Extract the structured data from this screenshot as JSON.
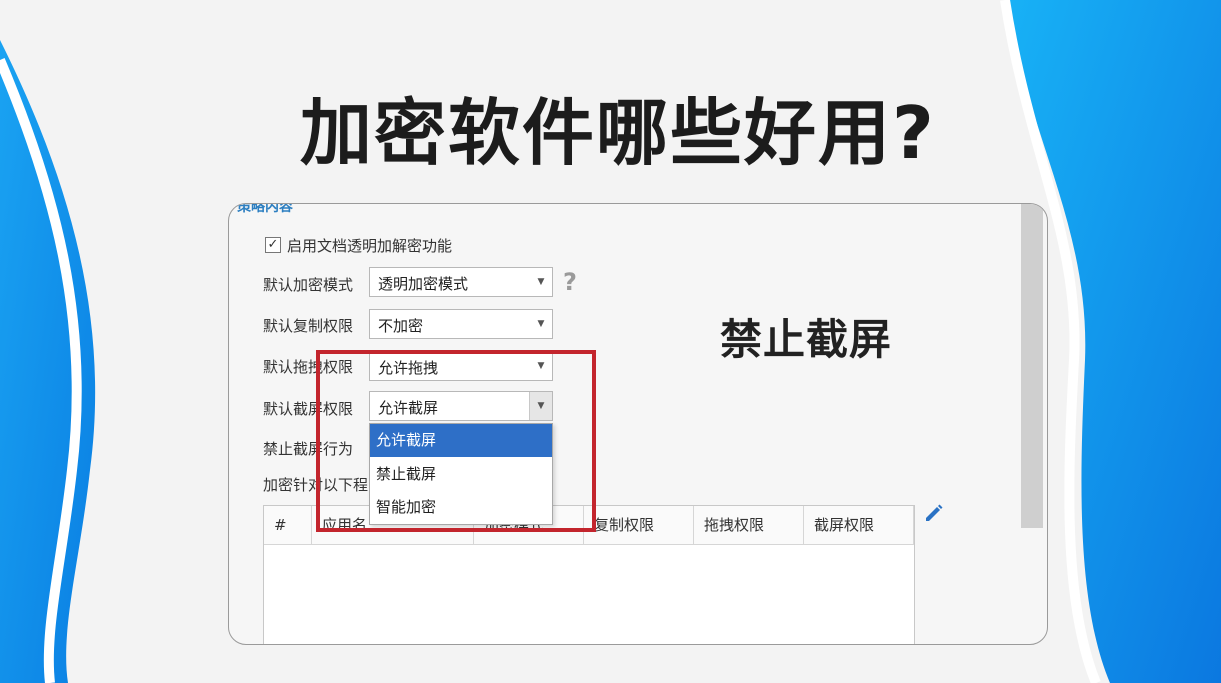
{
  "headline": "加密软件哪些好用?",
  "callout": "禁止截屏",
  "settings": {
    "section_title": "策略内容",
    "enable_checkbox": {
      "checked": true,
      "label": "启用文档透明加解密功能"
    },
    "rows": [
      {
        "label": "默认加密模式",
        "value": "透明加密模式"
      },
      {
        "label": "默认复制权限",
        "value": "不加密"
      },
      {
        "label": "默认拖拽权限",
        "value": "允许拖拽"
      },
      {
        "label": "默认截屏权限",
        "value": "允许截屏"
      }
    ],
    "row5_label": "禁止截屏行为",
    "row6_label": "加密针对以下程",
    "dropdown_options": [
      "允许截屏",
      "禁止截屏",
      "智能加密"
    ],
    "dropdown_selected": "允许截屏",
    "table_headers": [
      "#",
      "应用名",
      "加密模式",
      "复制权限",
      "拖拽权限",
      "截屏权限"
    ]
  },
  "colors": {
    "accent_blue": "#2e6fc7",
    "highlight_red": "#c3252d",
    "wave_blue": "#1d9bf0"
  },
  "icons": {
    "help": "question-mark-icon",
    "edit": "pencil-icon",
    "arrow": "chevron-down-icon"
  }
}
